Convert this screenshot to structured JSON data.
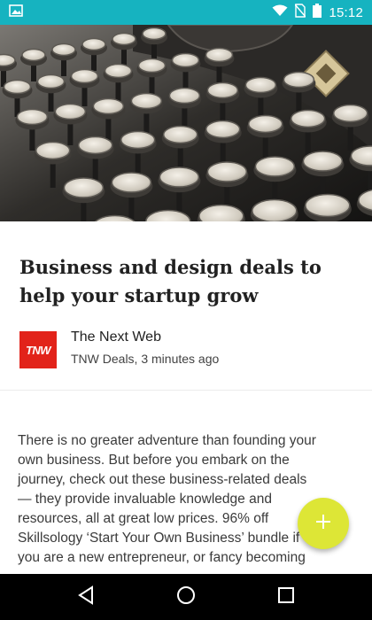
{
  "status_bar": {
    "time": "15:12",
    "icons": [
      "image-notification-icon",
      "wifi-icon",
      "no-sim-icon",
      "battery-icon"
    ]
  },
  "hero": {
    "image_subject": "vintage-typewriter-keys"
  },
  "article": {
    "title": "Business and design deals to help your startup grow",
    "source_name": "The Next Web",
    "source_logo_text": "TNW",
    "source_meta": "TNW Deals, 3 minutes ago",
    "body_lines": [
      "There is no greater adventure than founding your",
      "own business. But before you embark on the",
      "journey, check out these business-related deals",
      "— they provide invaluable knowledge and",
      "resources, all at great low prices. 96% off",
      "Skillsology ‘Start Your Own Business’ bundle if",
      "you are a new entrepreneur, or fancy becoming"
    ]
  },
  "fab": {
    "label": "+"
  },
  "colors": {
    "status_bar": "#16b3c0",
    "fab": "#dde636",
    "tnw_logo": "#e2231a"
  },
  "nav": {
    "icons": [
      "back-icon",
      "home-icon",
      "recents-icon"
    ]
  }
}
